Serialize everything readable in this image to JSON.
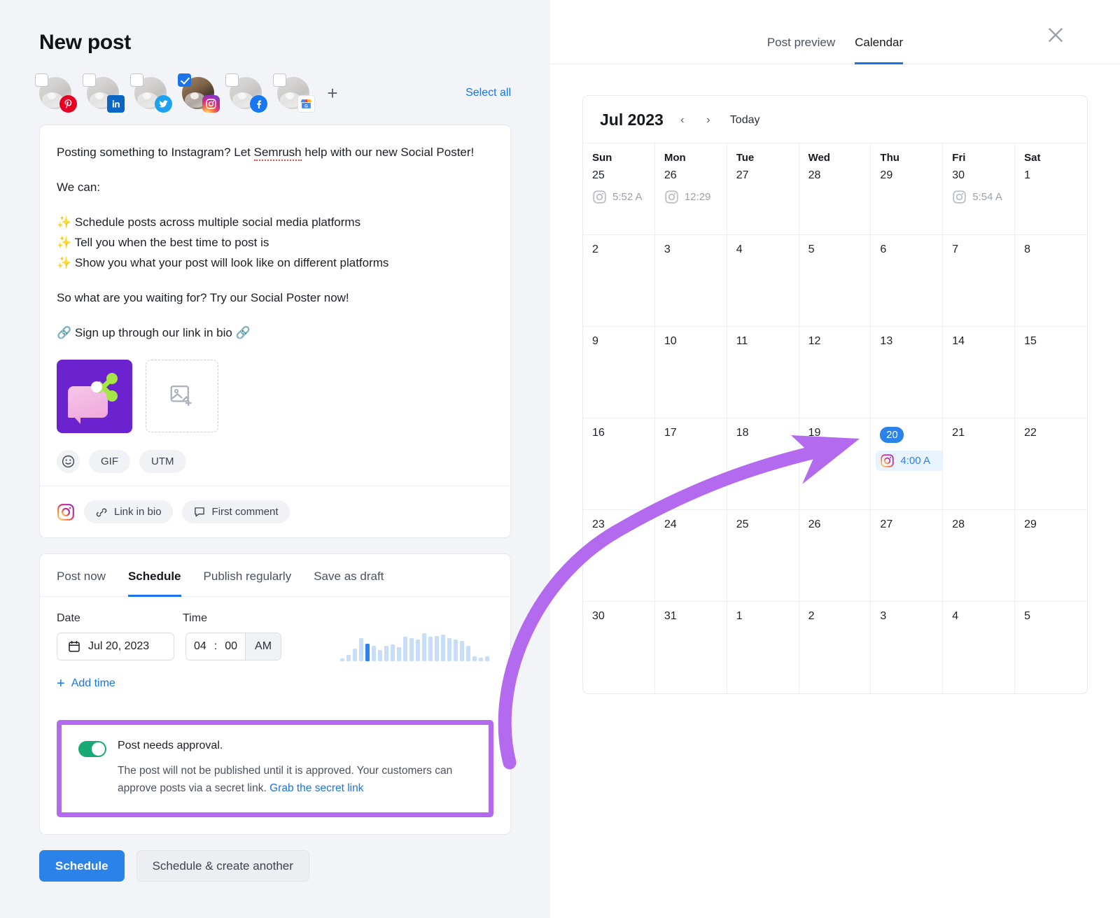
{
  "left": {
    "title": "New post",
    "accounts": [
      {
        "platform": "pinterest",
        "selected": false
      },
      {
        "platform": "linkedin",
        "selected": false
      },
      {
        "platform": "twitter",
        "selected": false
      },
      {
        "platform": "instagram",
        "selected": true
      },
      {
        "platform": "facebook",
        "selected": false
      },
      {
        "platform": "google-business",
        "selected": false
      }
    ],
    "add_account_label": "+",
    "select_all_label": "Select all",
    "post_text": {
      "p1": "Posting something to Instagram? Let ",
      "p1_spell": "Semrush",
      "p1_rest": " help with our new Social Poster!",
      "p2": "We can:",
      "bullet1": "Schedule posts across multiple social media platforms",
      "bullet2": "Tell you when the best time to post is",
      "bullet3": "Show you what your post will look like on different platforms",
      "bullet_icon": "✨",
      "p3": "So what are you waiting for? Try our Social Poster now!",
      "p4_icon": "🔗",
      "p4": "Sign up through our link in bio"
    },
    "media": {
      "thumb_name": "social-poster-thumbnail",
      "dropzone_name": "add-image-dropzone"
    },
    "chips": {
      "emoji": "☺",
      "gif": "GIF",
      "utm": "UTM"
    },
    "footer_chips": {
      "link_in_bio": "Link in bio",
      "first_comment": "First comment"
    },
    "schedule_tabs": [
      {
        "label": "Post now",
        "active": false
      },
      {
        "label": "Schedule",
        "active": true
      },
      {
        "label": "Publish regularly",
        "active": false
      },
      {
        "label": "Save as draft",
        "active": false
      }
    ],
    "schedule": {
      "date_label": "Date",
      "time_label": "Time",
      "date_value": "Jul 20, 2023",
      "time_hour": "04",
      "time_sep": ":",
      "time_minute": "00",
      "time_ampm": "AM",
      "add_time_label": "Add time",
      "add_time_plus": "+"
    },
    "approval": {
      "enabled": true,
      "title": "Post needs approval.",
      "description": "The post will not be published until it is approved. Your customers can approve posts via a secret link. ",
      "link_label": "Grab the secret link"
    },
    "actions": {
      "primary": "Schedule",
      "secondary": "Schedule & create another"
    }
  },
  "right": {
    "tabs": [
      {
        "label": "Post preview",
        "active": false
      },
      {
        "label": "Calendar",
        "active": true
      }
    ],
    "close_icon": "close-icon",
    "calendar": {
      "month": "Jul 2023",
      "today_label": "Today",
      "prev_icon": "‹",
      "next_icon": "›",
      "dow": [
        "Sun",
        "Mon",
        "Tue",
        "Wed",
        "Thu",
        "Fri",
        "Sat"
      ],
      "weeks": [
        [
          {
            "day": "25",
            "muted": true,
            "events": [
              {
                "time": "5:52 A",
                "active": false
              }
            ]
          },
          {
            "day": "26",
            "muted": true,
            "events": [
              {
                "time": "12:29",
                "active": false
              }
            ]
          },
          {
            "day": "27",
            "muted": true,
            "events": []
          },
          {
            "day": "28",
            "muted": true,
            "events": []
          },
          {
            "day": "29",
            "muted": true,
            "events": []
          },
          {
            "day": "30",
            "muted": true,
            "events": [
              {
                "time": "5:54 A",
                "active": false
              }
            ]
          },
          {
            "day": "1",
            "muted": false,
            "events": []
          }
        ],
        [
          {
            "day": "2",
            "events": []
          },
          {
            "day": "3",
            "events": []
          },
          {
            "day": "4",
            "events": []
          },
          {
            "day": "5",
            "events": []
          },
          {
            "day": "6",
            "events": []
          },
          {
            "day": "7",
            "events": []
          },
          {
            "day": "8",
            "events": []
          }
        ],
        [
          {
            "day": "9",
            "events": []
          },
          {
            "day": "10",
            "events": []
          },
          {
            "day": "11",
            "events": []
          },
          {
            "day": "12",
            "events": []
          },
          {
            "day": "13",
            "events": []
          },
          {
            "day": "14",
            "events": []
          },
          {
            "day": "15",
            "events": []
          }
        ],
        [
          {
            "day": "16",
            "events": []
          },
          {
            "day": "17",
            "events": []
          },
          {
            "day": "18",
            "events": []
          },
          {
            "day": "19",
            "events": []
          },
          {
            "day": "20",
            "selected": true,
            "events": [
              {
                "time": "4:00 A",
                "active": true
              }
            ]
          },
          {
            "day": "21",
            "events": []
          },
          {
            "day": "22",
            "events": []
          }
        ],
        [
          {
            "day": "23",
            "events": []
          },
          {
            "day": "24",
            "events": []
          },
          {
            "day": "25",
            "events": []
          },
          {
            "day": "26",
            "events": []
          },
          {
            "day": "27",
            "events": []
          },
          {
            "day": "28",
            "events": []
          },
          {
            "day": "29",
            "events": []
          }
        ],
        [
          {
            "day": "30",
            "events": []
          },
          {
            "day": "31",
            "events": []
          },
          {
            "day": "1",
            "events": []
          },
          {
            "day": "2",
            "events": []
          },
          {
            "day": "3",
            "events": []
          },
          {
            "day": "4",
            "events": []
          },
          {
            "day": "5",
            "events": []
          }
        ]
      ]
    }
  },
  "annotation": {
    "arrow_color": "#b36aee",
    "highlight_color": "#b36aee"
  },
  "chart_data": {
    "type": "bar",
    "title": "Best time to post",
    "categories": [
      "0",
      "1",
      "2",
      "3",
      "4",
      "5",
      "6",
      "7",
      "8",
      "9",
      "10",
      "11",
      "12",
      "13",
      "14",
      "15",
      "16",
      "17",
      "18",
      "19",
      "20",
      "21",
      "22",
      "23"
    ],
    "values": [
      2,
      5,
      10,
      18,
      14,
      12,
      9,
      12,
      13,
      11,
      19,
      18,
      17,
      22,
      19,
      20,
      21,
      18,
      17,
      16,
      12,
      4,
      3,
      4
    ],
    "selected_index": 4,
    "xlabel": "",
    "ylabel": "",
    "ylim": [
      0,
      24
    ]
  }
}
